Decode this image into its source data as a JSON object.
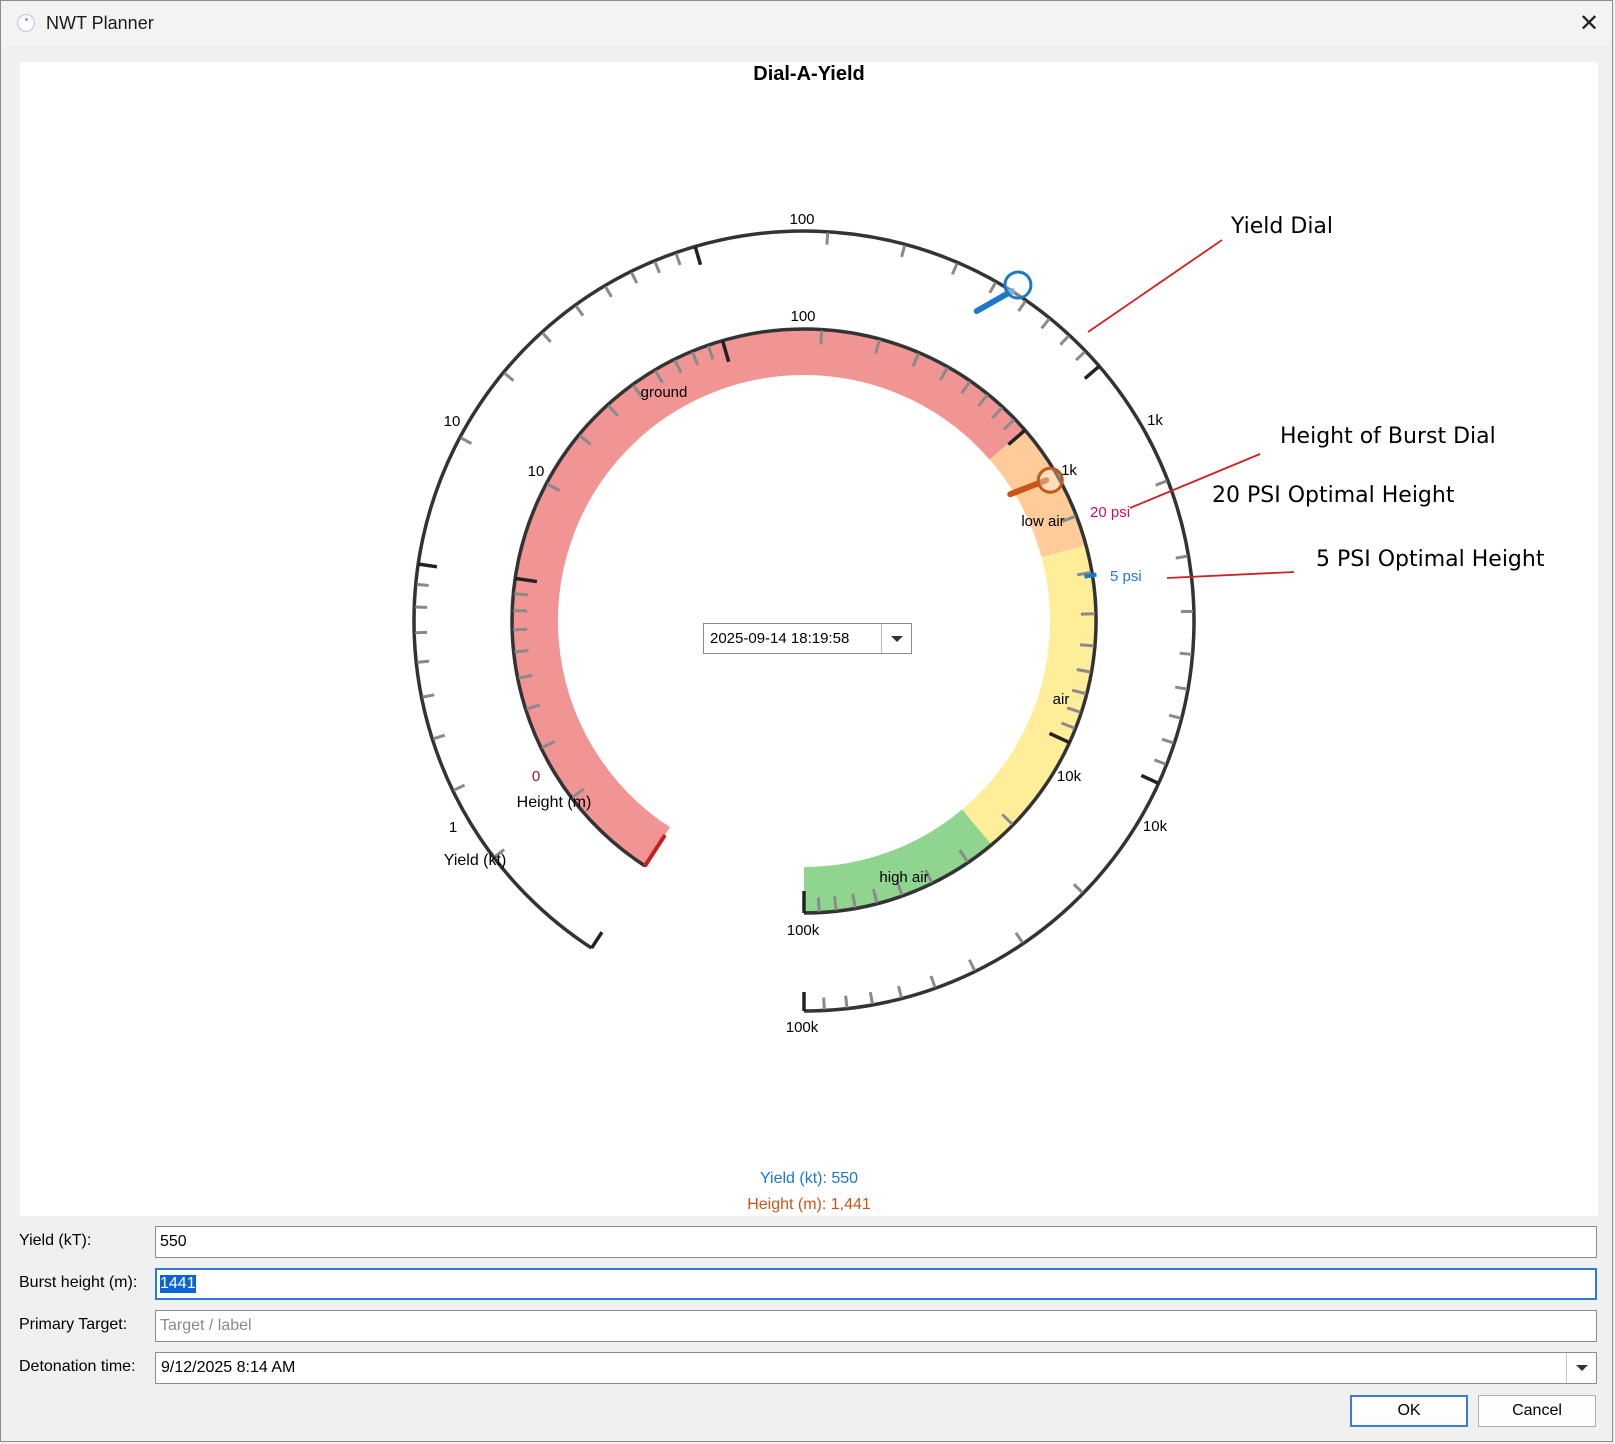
{
  "window": {
    "title": "NWT Planner",
    "close_glyph": "✕"
  },
  "icons": {
    "app": "nwt-app-icon",
    "close": "close-icon",
    "dropdown": "chevron-down-icon"
  },
  "colors": {
    "yield_accent": "#1e78c8",
    "height_accent": "#c8561a",
    "zone_ground": "#f19494",
    "zone_low_air": "#ffcc99",
    "zone_air": "#ffee99",
    "zone_high_air": "#8fd58f",
    "annotation_line": "#cc2222",
    "psi20_label": "#cc1155"
  },
  "chart": {
    "title": "Dial-A-Yield",
    "outer_dial": {
      "axis_label": "Yield (kt)",
      "tick_labels": [
        "1",
        "10",
        "100",
        "1k",
        "10k",
        "100k"
      ]
    },
    "inner_dial": {
      "axis_label": "Height (m)",
      "tick_labels": [
        "0",
        "10",
        "100",
        "1k",
        "10k",
        "100k"
      ]
    },
    "zones": [
      "ground",
      "low air",
      "air",
      "high air"
    ],
    "markers": {
      "psi20": "20 psi",
      "psi5": "5 psi"
    },
    "annotations": {
      "yield_dial": "Yield Dial",
      "hob_dial": "Height of Burst Dial",
      "psi20": "20 PSI Optimal Height",
      "psi5": "5 PSI Optimal Height"
    },
    "timestamp": "2025-09-14 18:19:58",
    "readout_yield": "Yield (kt): 550",
    "readout_height": "Height (m): 1,441"
  },
  "chart_data": {
    "type": "other",
    "title": "Dial-A-Yield",
    "yield_kt": 550,
    "height_m": 1441,
    "outer_scale": {
      "label": "Yield (kt)",
      "scale": "log",
      "range": [
        1,
        100000
      ]
    },
    "inner_scale": {
      "label": "Height (m)",
      "scale": "log",
      "range": [
        1,
        100000
      ]
    }
  },
  "form": {
    "yield_label": "Yield (kT):",
    "yield_value": "550",
    "height_label": "Burst height (m):",
    "height_value": "1441",
    "target_label": "Primary Target:",
    "target_value": "",
    "target_placeholder": "Target / label",
    "detonation_label": "Detonation time:",
    "detonation_value": "9/12/2025 8:14 AM"
  },
  "buttons": {
    "ok": "OK",
    "cancel": "Cancel"
  }
}
